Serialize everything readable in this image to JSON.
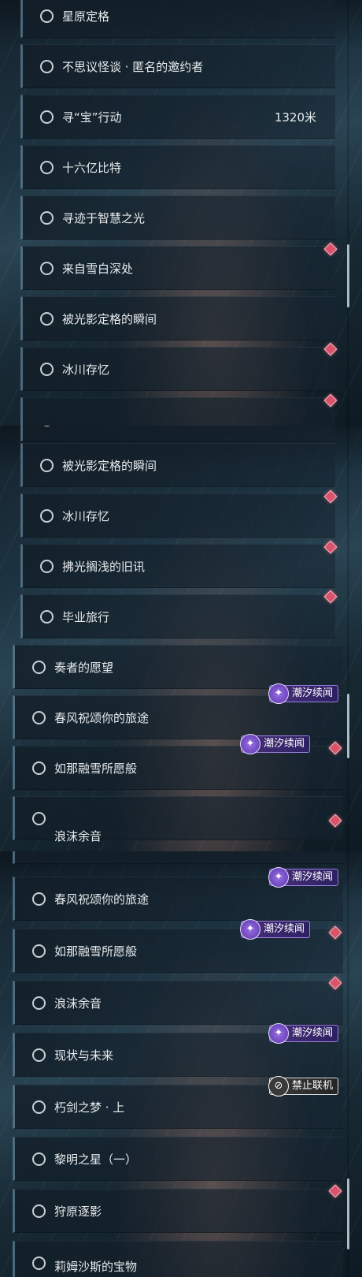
{
  "tags": {
    "chaoxi": "潮汐续闻",
    "forbid": "禁止联机"
  },
  "panel1": {
    "quests": [
      {
        "label": "星原定格"
      },
      {
        "label": "不思议怪谈 · 匿名的邀约者"
      },
      {
        "label": "寻“宝”行动",
        "distance": "1320米"
      },
      {
        "label": "十六亿比特"
      },
      {
        "label": "寻迹于智慧之光"
      },
      {
        "label": "来自雪白深处"
      },
      {
        "label": "被光影定格的瞬间"
      },
      {
        "label": "冰川存忆"
      },
      {
        "label": ""
      }
    ]
  },
  "panel2": {
    "quests": [
      {
        "label": "来自雪白深处"
      },
      {
        "label": "被光影定格的瞬间"
      },
      {
        "label": "冰川存忆"
      },
      {
        "label": "拂光搁浅的旧讯"
      },
      {
        "label": "毕业旅行"
      },
      {
        "label": "奏者的愿望"
      },
      {
        "label": "春风祝颂你的旅途"
      },
      {
        "label": "如那融雪所愿般"
      },
      {
        "label": "浪沫余音"
      }
    ]
  },
  "panel3": {
    "quests": [
      {
        "label": ""
      },
      {
        "label": "春风祝颂你的旅途"
      },
      {
        "label": "如那融雪所愿般"
      },
      {
        "label": "浪沫余音"
      },
      {
        "label": "现状与未来"
      },
      {
        "label": "朽剑之梦 · 上"
      },
      {
        "label": "黎明之星（一）"
      },
      {
        "label": "狩原逐影"
      },
      {
        "label": "莉姆沙斯的宝物"
      }
    ]
  },
  "colors": {
    "accent_tag": "#4a2f7a",
    "marker": "#d9546a",
    "forbid_tag": "#3b3b3b"
  },
  "icons": {
    "quest_status": "circle-outline-icon",
    "tag_chaoxi": "sparkle-crescent-icon",
    "tag_forbid": "no-multiplayer-icon",
    "marker": "red-diamond-icon"
  }
}
